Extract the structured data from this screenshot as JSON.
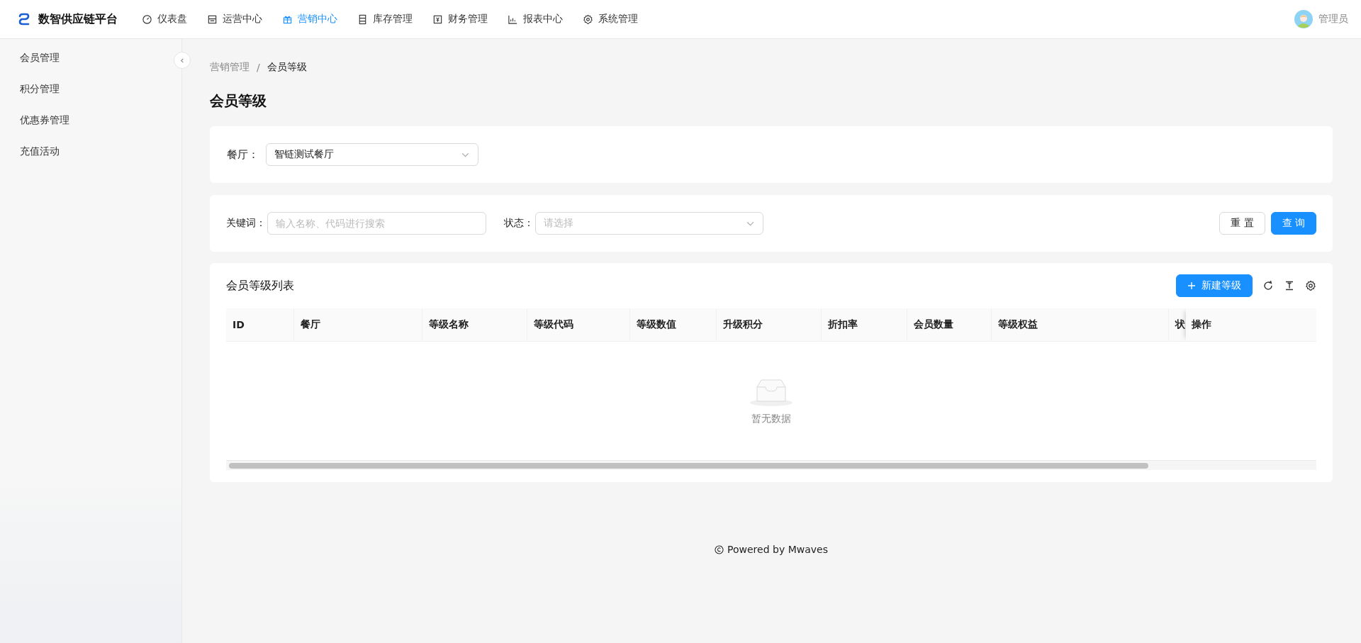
{
  "header": {
    "logo_text": "数智供应链平台",
    "nav": [
      {
        "label": "仪表盘",
        "selected": false
      },
      {
        "label": "运营中心",
        "selected": false
      },
      {
        "label": "营销中心",
        "selected": true
      },
      {
        "label": "库存管理",
        "selected": false
      },
      {
        "label": "财务管理",
        "selected": false
      },
      {
        "label": "报表中心",
        "selected": false
      },
      {
        "label": "系统管理",
        "selected": false
      }
    ],
    "user": "管理员"
  },
  "sidebar": {
    "items": [
      {
        "label": "会员管理",
        "selected": false
      },
      {
        "label": "积分管理",
        "selected": false
      },
      {
        "label": "优惠券管理",
        "selected": false
      },
      {
        "label": "充值活动",
        "selected": false
      }
    ]
  },
  "breadcrumb": [
    "营销管理",
    "/",
    "会员等级"
  ],
  "page_title": "会员等级",
  "restaurant_filter": {
    "label": "餐厅：",
    "value": "智链测试餐厅"
  },
  "search": {
    "keyword_label": "关键词：",
    "keyword_placeholder": "输入名称、代码进行搜索",
    "status_label": "状态：",
    "status_placeholder": "请选择",
    "buttons": [
      {
        "label": "重 置",
        "kind": "default"
      },
      {
        "label": "查 询",
        "kind": "primary"
      }
    ]
  },
  "table": {
    "title": "会员等级列表",
    "add_button": "新建等级",
    "columns": [
      "ID",
      "餐厅",
      "等级名称",
      "等级代码",
      "等级数值",
      "升级积分",
      "折扣率",
      "会员数量",
      "等级权益",
      "状"
    ],
    "action_column": "操作",
    "empty_text": "暂无数据"
  },
  "footer": "Powered by Mwaves"
}
